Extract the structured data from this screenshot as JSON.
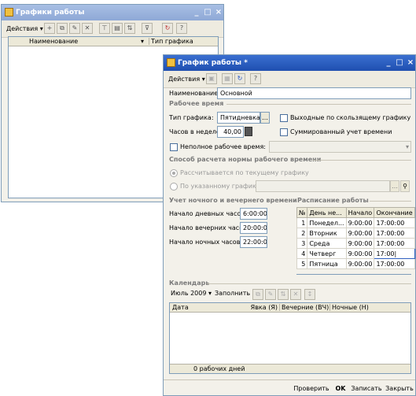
{
  "back_window": {
    "title": "Графики работы",
    "actions_label": "Действия",
    "columns": [
      "Наименование",
      "Тип графика"
    ]
  },
  "front_window": {
    "title": "График работы *",
    "actions_label": "Действия",
    "name_label": "Наименование:",
    "name_value": "Основной",
    "section_work_time": "Рабочее время",
    "schedule_type_label": "Тип графика:",
    "schedule_type_value": "Пятидневка",
    "sliding_holidays_label": "Выходные по скользящему графику",
    "hours_week_label": "Часов в неделе:",
    "hours_week_value": "40,00",
    "summed_time_label": "Суммированный учет времени",
    "part_time_label": "Неполное рабочее время:",
    "section_norm_calc": "Способ расчета нормы рабочего времени",
    "radio_current_label": "Рассчитывается по текущему графику",
    "radio_specified_label": "По указанному графику:",
    "section_night_evening": "Учет ночного и вечернего времени",
    "day_hours_label": "Начало дневных часов:",
    "day_hours_value": "6:00:00",
    "evening_hours_label": "Начало вечерних часов:",
    "evening_hours_value": "20:00:00",
    "night_hours_label": "Начало ночных часов:",
    "night_hours_value": "22:00:00",
    "section_schedule": "Расписание работы",
    "schedule_columns": [
      "№",
      "День не...",
      "Начало",
      "Окончание"
    ],
    "schedule_rows": [
      [
        "1",
        "Понедел...",
        "9:00:00",
        "17:00:00"
      ],
      [
        "2",
        "Вторник",
        "9:00:00",
        "17:00:00"
      ],
      [
        "3",
        "Среда",
        "9:00:00",
        "17:00:00"
      ],
      [
        "4",
        "Четверг",
        "9:00:00",
        "17:00|"
      ],
      [
        "5",
        "Пятница",
        "9:00:00",
        "17:00:00"
      ]
    ],
    "section_calendar": "Календарь",
    "month_value": "Июль 2009",
    "fill_label": "Заполнить",
    "calendar_columns": [
      "Дата",
      "Явка (Я)",
      "Вечерние (ВЧ)",
      "Ночные (Н)"
    ],
    "calendar_footer": "0 рабочих дней",
    "button_check": "Проверить",
    "button_ok": "OK",
    "button_save": "Записать",
    "button_close": "Закрыть"
  }
}
